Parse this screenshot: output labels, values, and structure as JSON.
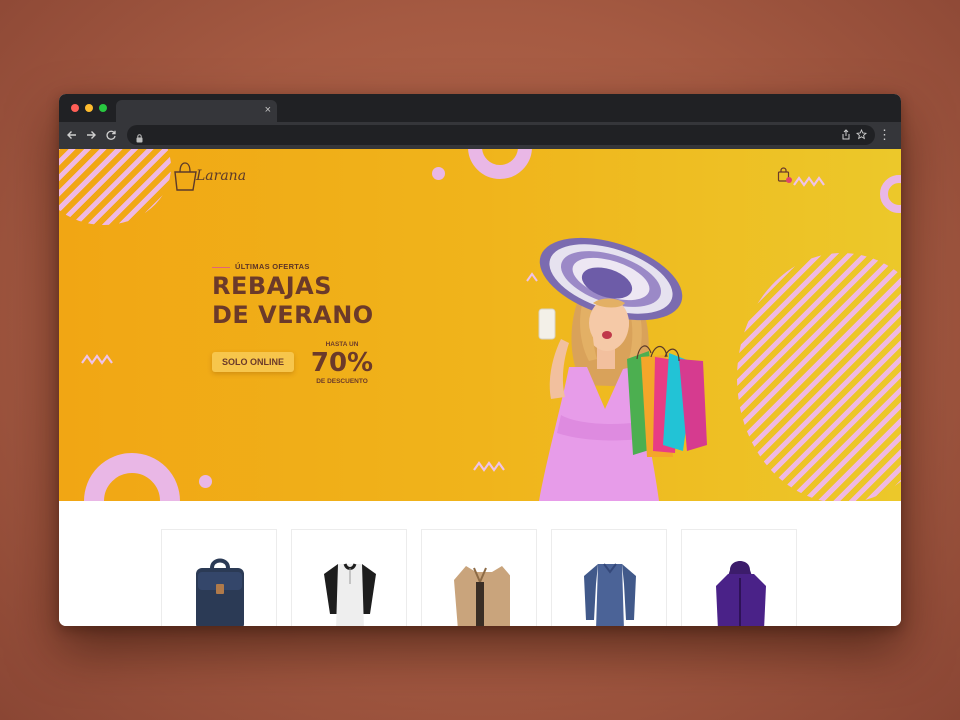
{
  "browser": {
    "tab": {
      "close_glyph": "×"
    },
    "toolbar": {
      "back_icon": "arrow-left-icon",
      "forward_icon": "arrow-right-icon",
      "reload_icon": "reload-icon",
      "menu_glyph": "⋮"
    }
  },
  "brand": {
    "name": "Larana"
  },
  "hero": {
    "eyebrow": "ÚLTIMAS OFERTAS",
    "headline_line1": "REBAJAS",
    "headline_line2": "DE VERANO",
    "badge": "SOLO ONLINE",
    "hasta": "HASTA UN",
    "discount": "70%",
    "descuento": "DE DESCUENTO"
  },
  "products": [
    {
      "name": "backpack",
      "icon": "backpack-icon"
    },
    {
      "name": "henley-shirt",
      "icon": "henley-shirt-icon"
    },
    {
      "name": "trench-jacket",
      "icon": "jacket-icon"
    },
    {
      "name": "long-sleeve-tee",
      "icon": "long-sleeve-shirt-icon"
    },
    {
      "name": "hooded-jacket",
      "icon": "hooded-jacket-icon"
    }
  ],
  "colors": {
    "hero_orange": "#f1a614",
    "hero_yellow": "#ecc82a",
    "headline_brown": "#6b3a2a",
    "decor_pink": "#e9b7e6",
    "badge_yellow": "#f7c64c"
  }
}
